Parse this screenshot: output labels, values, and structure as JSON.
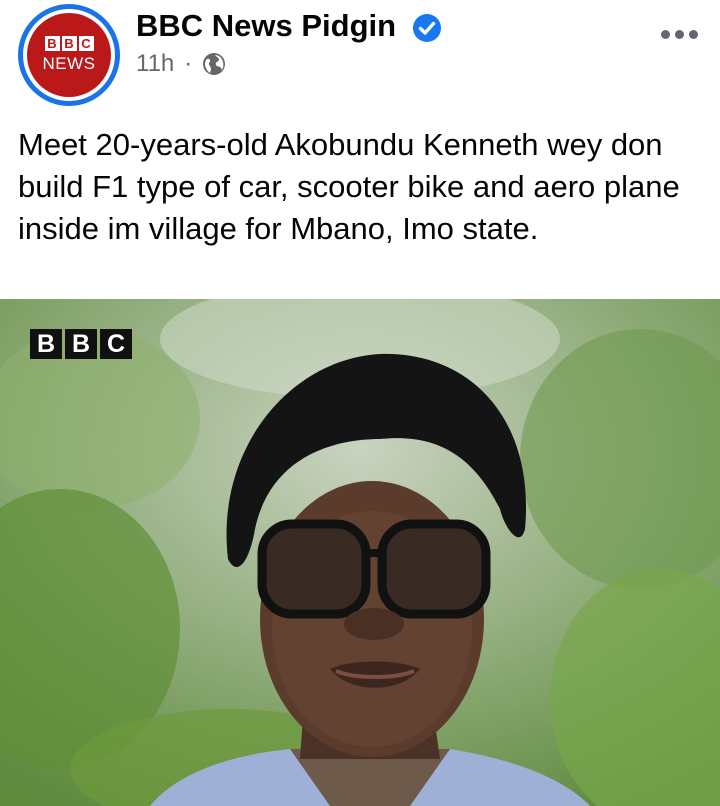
{
  "post": {
    "page_name": "BBC News Pidgin",
    "verified_icon": "verified-badge-icon",
    "timestamp": "11h",
    "separator": "·",
    "audience_icon": "globe-icon",
    "more_icon": "more-options-icon",
    "text": "Meet 20-years-old Akobundu Kenneth wey don build F1 type of car, scooter bike and aero plane inside im village for Mbano, Imo state."
  },
  "avatar": {
    "logo_letters": [
      "B",
      "B",
      "C"
    ],
    "logo_word": "NEWS",
    "ring_color": "#1a73e8",
    "brand_color": "#bb1919"
  },
  "media": {
    "watermark_letters": [
      "B",
      "B",
      "C"
    ]
  },
  "colors": {
    "verified": "#1877f2",
    "secondary_text": "#65676b"
  }
}
